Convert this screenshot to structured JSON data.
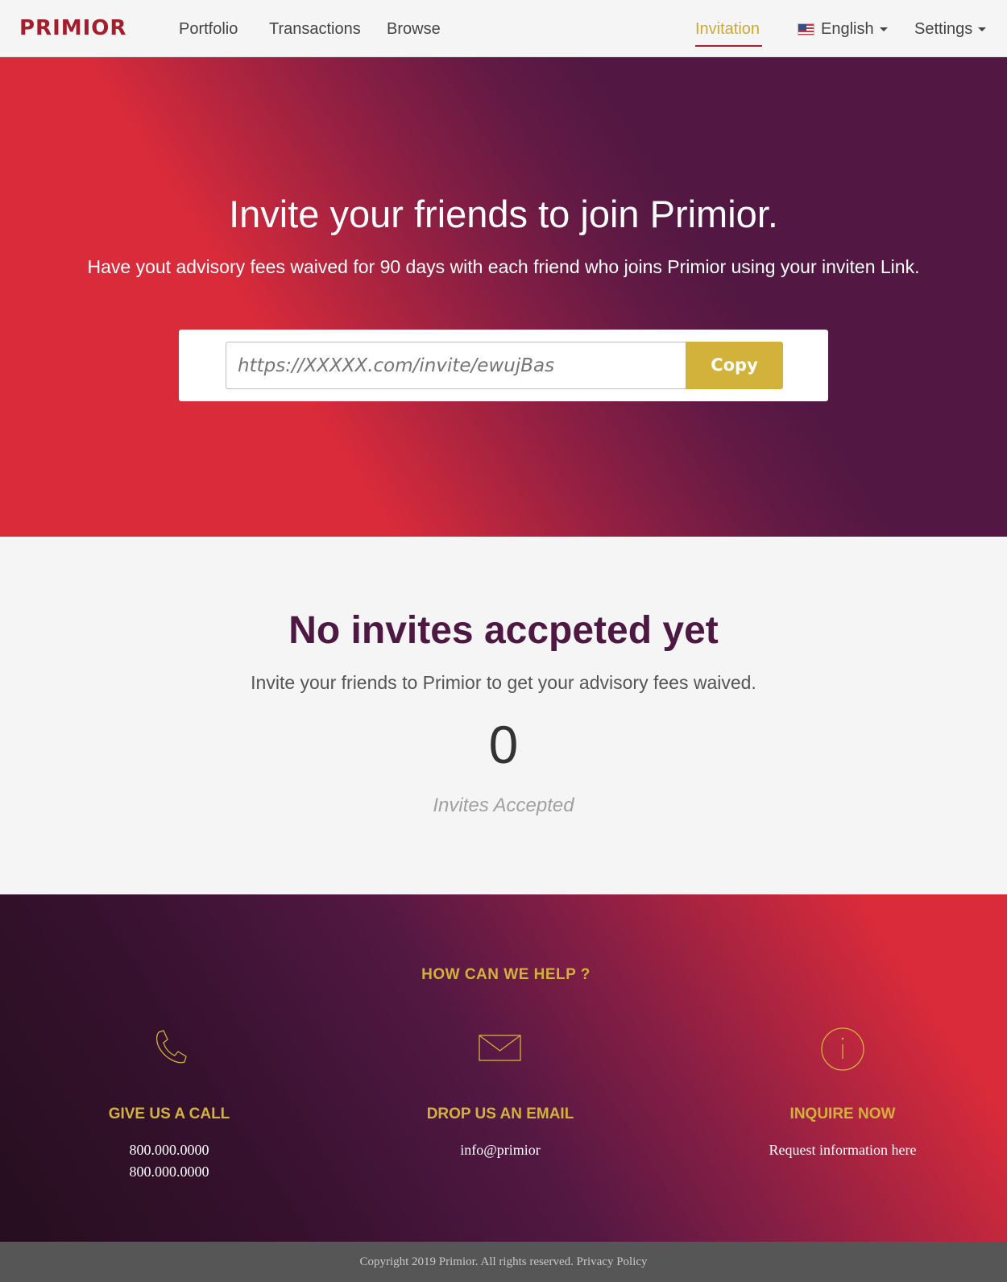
{
  "brand": {
    "logo_text": "PRIMIOR",
    "logo_color": "#a31d2c"
  },
  "nav": {
    "links": [
      {
        "label": "Portfolio"
      },
      {
        "label": "Transactions"
      },
      {
        "label": "Browse"
      }
    ],
    "active": {
      "label": "Invitation",
      "color": "#cfa92f"
    },
    "language": {
      "label": "English",
      "flag": "us-flag-icon"
    },
    "settings": {
      "label": "Settings"
    }
  },
  "hero": {
    "title": "Invite your friends to join Primior.",
    "subtitle": "Have yout advisory fees waived for 90 days with each friend who joins Primior using your inviten Link.",
    "invite_link_placeholder": "https://XXXXX.com/invite/ewujBas",
    "copy_label": "Copy",
    "copy_color": "#d3b23c"
  },
  "stats": {
    "title": "No invites accpeted yet",
    "subtitle": "Invite your friends to Primior to get your advisory fees waived.",
    "count": "0",
    "count_label": "Invites Accepted"
  },
  "footer": {
    "heading": "HOW CAN WE HELP ?",
    "accent_color": "#d3b23c",
    "columns": [
      {
        "icon": "phone-icon",
        "title": "GIVE US A CALL",
        "lines": [
          "800.000.0000",
          "800.000.0000"
        ]
      },
      {
        "icon": "envelope-icon",
        "title": "DROP US AN EMAIL",
        "lines": [
          "info@primior"
        ]
      },
      {
        "icon": "info-icon",
        "title": "INQUIRE NOW",
        "lines": [
          "Request information here"
        ]
      }
    ],
    "copyright": "Copyright 2019 Primior. All rights reserved.",
    "privacy_label": "Privacy Policy"
  }
}
